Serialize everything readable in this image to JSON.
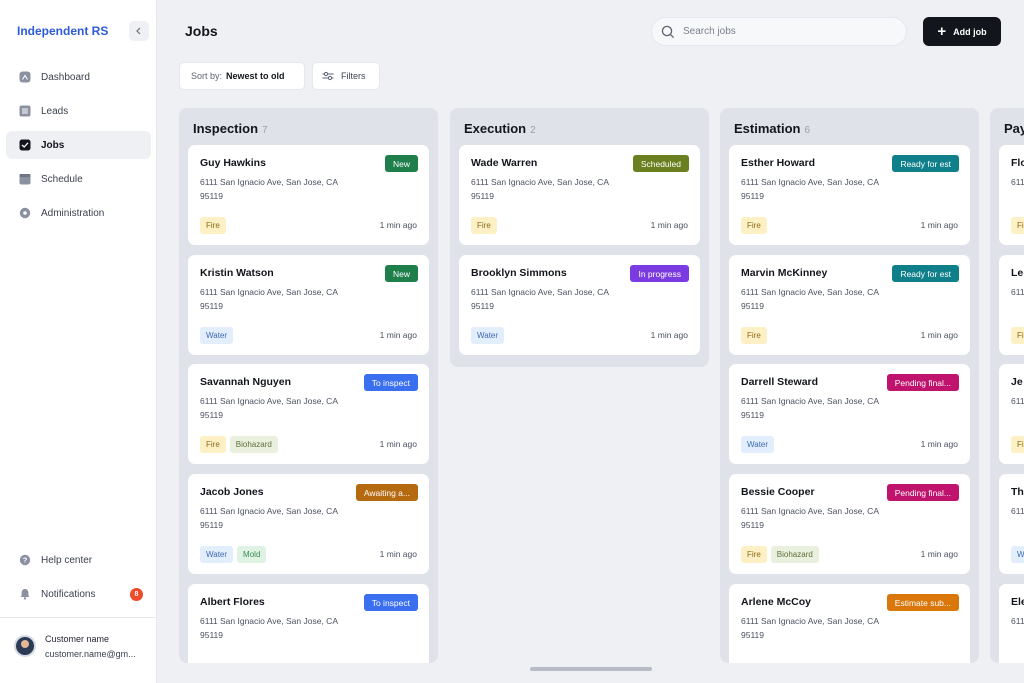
{
  "brand": "Independent RS",
  "sidebar": {
    "items": [
      {
        "label": "Dashboard",
        "icon": "dashboard-icon"
      },
      {
        "label": "Leads",
        "icon": "leads-icon"
      },
      {
        "label": "Jobs",
        "icon": "jobs-check-icon",
        "active": true
      },
      {
        "label": "Schedule",
        "icon": "schedule-icon"
      },
      {
        "label": "Administration",
        "icon": "gear-icon"
      }
    ],
    "bottom": [
      {
        "label": "Help center",
        "icon": "help-icon"
      },
      {
        "label": "Notifications",
        "icon": "bell-icon",
        "badge": "8"
      }
    ],
    "user": {
      "name": "Customer name",
      "email": "customer.name@gm..."
    }
  },
  "header": {
    "title": "Jobs",
    "search_placeholder": "Search jobs",
    "add_label": "Add job",
    "sort_label": "Sort by:",
    "sort_value": "Newest to old",
    "filters_label": "Filters"
  },
  "colors": {
    "accent": "#2d5bd7",
    "status_new": "#1e7f4b",
    "status_scheduled": "#6a7f1f",
    "status_inspect": "#3a6ff0",
    "status_awaiting": "#b56a10",
    "status_inprogress": "#7a3ce0",
    "status_ready": "#0f7f8a",
    "status_pending": "#c0136d",
    "status_estimate": "#d9770a"
  },
  "columns": [
    {
      "title": "Inspection",
      "count": "7",
      "cards": [
        {
          "name": "Guy Hawkins",
          "address": "6111 San Ignacio Ave, San Jose, CA 95119",
          "status": "New",
          "tags": [
            "Fire"
          ],
          "time": "1 min ago"
        },
        {
          "name": "Kristin Watson",
          "address": "6111 San Ignacio Ave, San Jose, CA 95119",
          "status": "New",
          "tags": [
            "Water"
          ],
          "time": "1 min ago"
        },
        {
          "name": "Savannah Nguyen",
          "address": "6111 San Ignacio Ave, San Jose, CA 95119",
          "status": "To inspect",
          "tags": [
            "Fire",
            "Biohazard"
          ],
          "time": "1 min ago"
        },
        {
          "name": "Jacob Jones",
          "address": "6111 San Ignacio Ave, San Jose, CA 95119",
          "status": "Awaiting a...",
          "tags": [
            "Water",
            "Mold"
          ],
          "time": "1 min ago"
        },
        {
          "name": "Albert Flores",
          "address": "6111 San Ignacio Ave, San Jose, CA 95119",
          "status": "To inspect",
          "tags": [],
          "time": ""
        }
      ]
    },
    {
      "title": "Execution",
      "count": "2",
      "cards": [
        {
          "name": "Wade Warren",
          "address": "6111 San Ignacio Ave, San Jose, CA 95119",
          "status": "Scheduled",
          "tags": [
            "Fire"
          ],
          "time": "1 min ago"
        },
        {
          "name": "Brooklyn Simmons",
          "address": "6111 San Ignacio Ave, San Jose, CA 95119",
          "status": "In progress",
          "tags": [
            "Water"
          ],
          "time": "1 min ago"
        }
      ]
    },
    {
      "title": "Estimation",
      "count": "6",
      "cards": [
        {
          "name": "Esther Howard",
          "address": "6111 San Ignacio Ave, San Jose, CA 95119",
          "status": "Ready for est",
          "tags": [
            "Fire"
          ],
          "time": "1 min ago"
        },
        {
          "name": "Marvin McKinney",
          "address": "6111 San Ignacio Ave, San Jose, CA 95119",
          "status": "Ready for est",
          "tags": [
            "Fire"
          ],
          "time": "1 min ago"
        },
        {
          "name": "Darrell Steward",
          "address": "6111 San Ignacio Ave, San Jose, CA 95119",
          "status": "Pending final...",
          "tags": [
            "Water"
          ],
          "time": "1 min ago"
        },
        {
          "name": "Bessie Cooper",
          "address": "6111 San Ignacio Ave, San Jose, CA 95119",
          "status": "Pending final...",
          "tags": [
            "Fire",
            "Biohazard"
          ],
          "time": "1 min ago"
        },
        {
          "name": "Arlene McCoy",
          "address": "6111 San Ignacio Ave, San Jose, CA 95119",
          "status": "Estimate sub...",
          "tags": [],
          "time": ""
        }
      ]
    },
    {
      "title": "Pay",
      "count": "",
      "cards": [
        {
          "name": "Flo",
          "address": "611 CA",
          "status": "",
          "tags": [
            "Fi"
          ],
          "time": ""
        },
        {
          "name": "Le",
          "address": "611 CA",
          "status": "",
          "tags": [
            "Fi"
          ],
          "time": ""
        },
        {
          "name": "Je",
          "address": "611 CA",
          "status": "",
          "tags": [
            "Fi"
          ],
          "time": ""
        },
        {
          "name": "Th",
          "address": "611 CA",
          "status": "",
          "tags": [
            "W"
          ],
          "time": ""
        },
        {
          "name": "Ele",
          "address": "611 CA",
          "status": "",
          "tags": [],
          "time": ""
        }
      ]
    }
  ]
}
